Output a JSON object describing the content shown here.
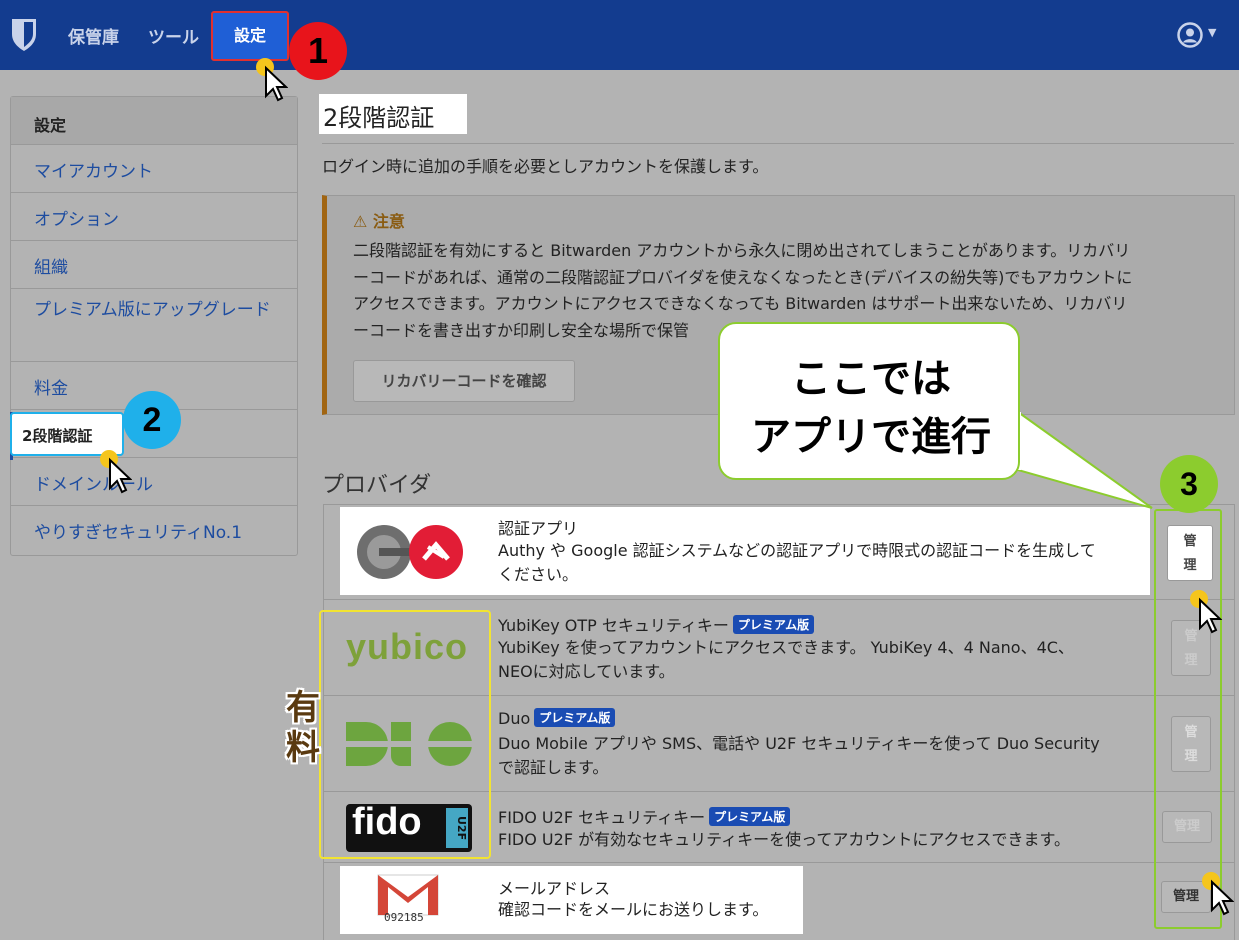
{
  "navbar": {
    "links": {
      "vault": "保管庫",
      "tools": "ツール",
      "settings": "設定"
    }
  },
  "badges": {
    "one": "1",
    "two": "2",
    "three": "3"
  },
  "sidebar": {
    "heading": "設定",
    "items": [
      {
        "label": "マイアカウント"
      },
      {
        "label": "オプション"
      },
      {
        "label": "組織"
      },
      {
        "label": "プレミアム版にアップグレード"
      },
      {
        "label": "料金"
      },
      {
        "label": "2段階認証"
      },
      {
        "label": "ドメインルール"
      },
      {
        "label": "やりすぎセキュリティNo.1"
      }
    ]
  },
  "main": {
    "title": "2段階認証",
    "intro": "ログイン時に追加の手順を必要としアカウントを保護します。",
    "warning": {
      "title": "注意",
      "lines": [
        "二段階認証を有効にすると Bitwarden アカウントから永久に閉め出されてしまうことがあります。リカバリ",
        "ーコードがあれば、通常の二段階認証プロバイダを使えなくなったとき(デバイスの紛失等)でもアカウントに",
        "アクセスできます。アカウントにアクセスできなくなっても Bitwarden はサポート出来ないため、リカバリ",
        "ーコードを書き出すか印刷し安全な場所で保管"
      ],
      "button": "リカバリーコードを確認"
    },
    "providers_heading": "プロバイダ",
    "premium_badge": "プレミアム版",
    "manage_label": "管理",
    "providers": [
      {
        "name": "認証アプリ",
        "desc": [
          "Authy や Google 認証システムなどの認証アプリで時限式の認証コードを生成して",
          "ください。"
        ],
        "premium": false
      },
      {
        "name": "YubiKey OTP セキュリティキー",
        "desc": [
          "YubiKey を使ってアカウントにアクセスできます。 YubiKey 4、4 Nano、4C、",
          "NEOに対応しています。"
        ],
        "premium": true,
        "logo_text": "yubico"
      },
      {
        "name": "Duo",
        "desc": [
          "Duo Mobile アプリや SMS、電話や U2F セキュリティキーを使って Duo Security",
          "で認証します。"
        ],
        "premium": true
      },
      {
        "name": "FIDO U2F セキュリティキー",
        "desc": [
          "FIDO U2F が有効なセキュリティキーを使ってアカウントにアクセスできます。"
        ],
        "premium": true,
        "logo_text": "fido",
        "logo_side": "U2F"
      },
      {
        "name": "メールアドレス",
        "desc": [
          "確認コードをメールにお送りします。"
        ],
        "premium": false,
        "logo_code": "092185"
      }
    ],
    "manage_button": {
      "vertical_1": "管",
      "vertical_2": "理"
    }
  },
  "annotations": {
    "callout_lines": [
      "ここでは",
      "アプリで進行"
    ],
    "paid_chars": [
      "有",
      "料"
    ]
  },
  "colors": {
    "navbar": "#133c8f",
    "link": "#1d4ca0",
    "badge_red": "#e8141b",
    "badge_blue": "#1fb0ea",
    "badge_green": "#8ccc2e",
    "premium": "#1a4cb3",
    "warning": "#a16512"
  }
}
